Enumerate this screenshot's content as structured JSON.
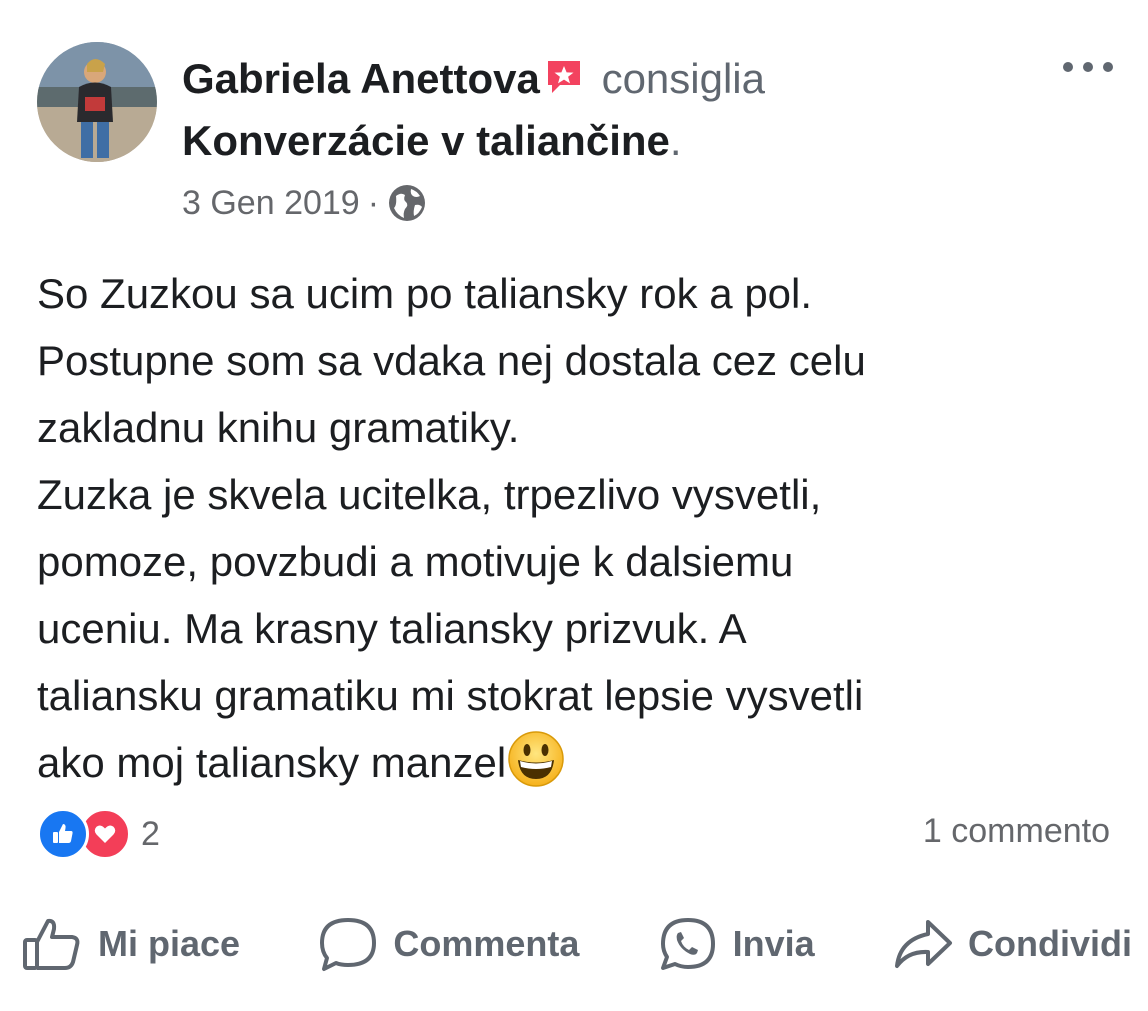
{
  "post": {
    "author": "Gabriela Anettova",
    "action_verb": "consiglia",
    "page_name": "Konverzácie v taliančine",
    "page_suffix": ".",
    "date": "3 Gen 2019",
    "separator": "·",
    "privacy_icon": "globe-icon",
    "recommend_icon": "recommend-flag-icon",
    "more_icon": "more-dots-icon",
    "body_lines": [
      "So Zuzkou sa ucim po taliansky rok a pol.",
      "Postupne som sa vdaka nej dostala cez celu",
      "zakladnu knihu gramatiky.",
      "Zuzka je skvela ucitelka, trpezlivo vysvetli,",
      "pomoze, povzbudi a motivuje k dalsiemu",
      "uceniu. Ma krasny taliansky prizvuk. A",
      "taliansku gramatiku mi stokrat lepsie vysvetli",
      "ako moj taliansky manzel"
    ],
    "emoji": "grinning-face-emoji"
  },
  "reactions": {
    "count": "2",
    "types": [
      "like",
      "love"
    ],
    "comments_label": "1 commento"
  },
  "actions": {
    "like_label": "Mi piace",
    "comment_label": "Commenta",
    "send_label": "Invia",
    "share_label": "Condividi"
  },
  "colors": {
    "text": "#1c1e21",
    "secondary": "#65676b",
    "like_blue": "#1877f2",
    "love_red": "#f33e58",
    "recommend_red": "#f3425f"
  }
}
